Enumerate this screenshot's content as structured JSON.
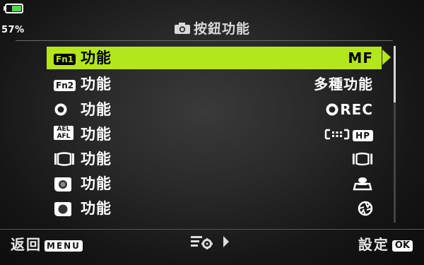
{
  "status": {
    "battery_percent": "57%"
  },
  "header": {
    "title": "按鈕功能",
    "icon": "camera-icon"
  },
  "menu": {
    "items": [
      {
        "icon_text": "Fn1",
        "label": "功能",
        "value": "MF",
        "selected": true
      },
      {
        "icon_text": "Fn2",
        "label": "功能",
        "value": "多種功能",
        "selected": false
      },
      {
        "icon": "record-button-icon",
        "label": "功能",
        "value": "REC",
        "value_icon": "record-icon",
        "selected": false
      },
      {
        "icon_text_top": "AEL",
        "icon_text_bottom": "AFL",
        "label": "功能",
        "value_icon": "af-target-icon",
        "value_badge": "HP",
        "selected": false
      },
      {
        "icon": "preview-bracket-icon",
        "label": "功能",
        "value_icon": "preview-bracket-icon",
        "selected": false
      },
      {
        "icon": "lens-button-1-icon",
        "label": "功能",
        "value_icon": "magnify-person-icon",
        "selected": false
      },
      {
        "icon": "lens-button-2-icon",
        "label": "功能",
        "value_icon": "aperture-icon",
        "selected": false
      }
    ]
  },
  "footer": {
    "back_label": "返回",
    "back_badge": "MENU",
    "middle_icon": "menu-settings-icon",
    "ok_label": "設定",
    "ok_badge": "OK"
  },
  "colors": {
    "highlight": "#b4e61e",
    "background": "#2a2a2a",
    "text": "#ffffff"
  }
}
